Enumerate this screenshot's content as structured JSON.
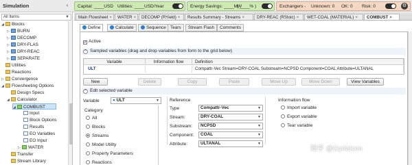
{
  "nav": {
    "title": "Simulation",
    "filter": "All Items",
    "items": [
      {
        "label": "Blocks",
        "icon": "folder-icon"
      },
      {
        "label": "BURN",
        "icon": "block-icon"
      },
      {
        "label": "DECOMP",
        "icon": "block-icon"
      },
      {
        "label": "DRY-FLAS",
        "icon": "block-icon"
      },
      {
        "label": "DRY-REAC",
        "icon": "block-icon"
      },
      {
        "label": "SEPARATE",
        "icon": "block-icon"
      },
      {
        "label": "Utilities",
        "icon": "folder-icon"
      },
      {
        "label": "Reactions",
        "icon": "folder-icon"
      },
      {
        "label": "Convergence",
        "icon": "folder-icon"
      },
      {
        "label": "Flowsheeting Options",
        "icon": "folder-icon"
      },
      {
        "label": "Design Specs",
        "icon": "folder-icon"
      },
      {
        "label": "Calculator",
        "icon": "folder-icon"
      },
      {
        "label": "COMBUST",
        "icon": "block-icon"
      },
      {
        "label": "Input",
        "icon": "form-icon"
      },
      {
        "label": "Block Options",
        "icon": "form-icon"
      },
      {
        "label": "Results",
        "icon": "form-icon"
      },
      {
        "label": "EO Variables",
        "icon": "form-icon"
      },
      {
        "label": "EO Input",
        "icon": "form-icon"
      },
      {
        "label": "WATER",
        "icon": "block-icon"
      },
      {
        "label": "Transfer",
        "icon": "folder-icon"
      },
      {
        "label": "Stream Library",
        "icon": "folder-icon"
      }
    ]
  },
  "topbar": {
    "capital": "Capital: ____USD",
    "utilities": "Utilities: ____USD/Year",
    "energy": "Energy Savings: ____MW",
    "energy_pct": "( ____% )",
    "exchangers": "Exchangers -",
    "unknown": "Unknown: 0",
    "ok": "OK: 0",
    "risk": "Risk: 0"
  },
  "doctabs": [
    {
      "label": "Main Flowsheet"
    },
    {
      "label": "WATER"
    },
    {
      "label": "DECOMP (RYield)"
    },
    {
      "label": "Results Summary - Streams"
    },
    {
      "label": "DRY-REAC (RStoic)"
    },
    {
      "label": "WET-COAL (MATERIAL)"
    },
    {
      "label": "COMBUST"
    }
  ],
  "formtabs": [
    "Define",
    "Calculate",
    "Sequence",
    "Tears",
    "Stream Flash",
    "Comments"
  ],
  "form": {
    "active_label": "Active",
    "sampled_header": "Sampled variables (drag and drop variables from form to the grid below)",
    "grid_headers": [
      "Variable",
      "Information flow",
      "Definition"
    ],
    "grid_row": {
      "variable": "ULT",
      "info_flow": "",
      "definition": "Compattr-Vec Stream=DRY-COAL Substream=NCPSD Component=COAL Attribute=ULTANAL"
    },
    "buttons": [
      "New",
      "Delete",
      "Copy",
      "Paste",
      "Move Up",
      "Move Down",
      "View Variables"
    ],
    "edit_header": "Edit selected variable",
    "variable_label": "Variable",
    "variable_value": "ULT",
    "category_title": "Category",
    "categories": [
      "All",
      "Blocks",
      "Streams",
      "Model Utility",
      "Property Parameters",
      "Reactions"
    ],
    "reference_title": "Reference",
    "reference": [
      {
        "label": "Type",
        "value": "Compattr-Vec"
      },
      {
        "label": "Stream:",
        "value": "DRY-COAL"
      },
      {
        "label": "Substream:",
        "value": "NCPSD"
      },
      {
        "label": "Component:",
        "value": "COAL"
      },
      {
        "label": "Attribute:",
        "value": "ULTANAL"
      }
    ],
    "info_flow_title": "Information flow",
    "info_flow_options": [
      "Import variable",
      "Export variable",
      "Tear variable"
    ]
  },
  "watermark": "知乎 @Gyrfalcon"
}
